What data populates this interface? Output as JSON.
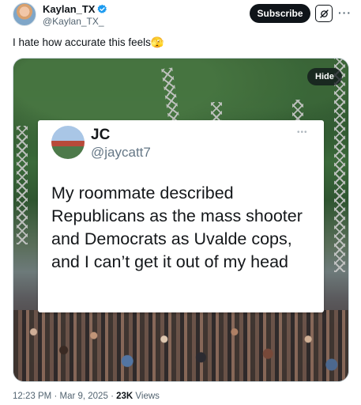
{
  "author": {
    "display_name": "Kaylan_TX",
    "handle": "@Kaylan_TX_",
    "verified": true
  },
  "actions": {
    "subscribe_label": "Subscribe",
    "grok_icon": "grok-icon",
    "more_icon": "more-options-icon"
  },
  "post": {
    "text": "I hate how accurate this feels",
    "emoji": "🫣"
  },
  "media": {
    "hide_label": "Hide",
    "embedded_card": {
      "name": "JC",
      "handle": "@jaycatt7",
      "text": "My roommate described Republicans as the mass shooter and Democrats as Uvalde cops, and I can’t get it out of my head"
    }
  },
  "meta": {
    "time": "12:23 PM",
    "date": "Mar 9, 2025",
    "separator": "·",
    "views_count": "23K",
    "views_label": "Views"
  },
  "colors": {
    "text_primary": "#0f1419",
    "text_secondary": "#536471",
    "verified_blue": "#1d9bf0",
    "subscribe_bg": "#0f1419"
  }
}
